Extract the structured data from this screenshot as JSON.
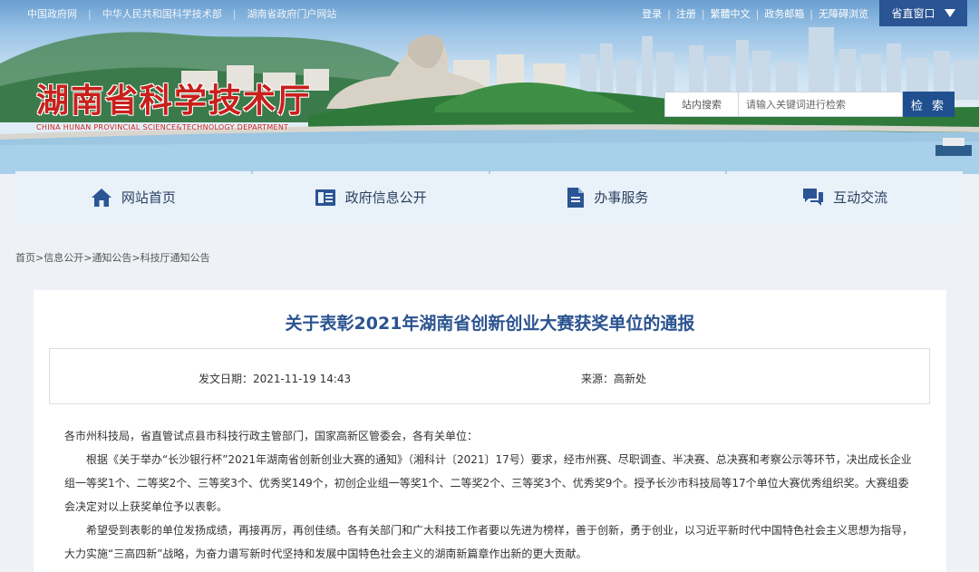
{
  "topbar": {
    "left_links": [
      "中国政府网",
      "中华人民共和国科学技术部",
      "湖南省政府门户网站"
    ],
    "right_links": [
      "登录",
      "注册",
      "繁體中文",
      "政务邮箱",
      "无障碍浏览"
    ],
    "region_button": "省直窗口"
  },
  "banner": {
    "site_title": "湖南省科学技术厅",
    "site_subtitle": "CHINA HUNAN PROVINCIAL SCIENCE&TECHNOLOGY DEPARTMENT"
  },
  "search": {
    "scope": "站内搜索",
    "placeholder": "请输入关键词进行检索",
    "button": "检 索"
  },
  "nav": {
    "items": [
      {
        "label": "网站首页",
        "icon": "home-icon"
      },
      {
        "label": "政府信息公开",
        "icon": "info-book-icon"
      },
      {
        "label": "办事服务",
        "icon": "document-icon"
      },
      {
        "label": "互动交流",
        "icon": "chat-icon"
      }
    ]
  },
  "breadcrumb": [
    "首页",
    "信息公开",
    "通知公告",
    "科技厅通知公告"
  ],
  "article": {
    "title": "关于表彰2021年湖南省创新创业大赛获奖单位的通报",
    "date_label": "发文日期：",
    "date": "2021-11-19 14:43",
    "source_label": "来源：",
    "source": "高新处",
    "paragraphs": [
      "各市州科技局，省直管试点县市科技行政主管部门，国家高新区管委会，各有关单位：",
      "根据《关于举办“长沙银行杯”2021年湖南省创新创业大赛的通知》（湘科计〔2021〕17号）要求，经市州赛、尽职调查、半决赛、总决赛和考察公示等环节，决出成长企业组一等奖1个、二等奖2个、三等奖3个、优秀奖149个，初创企业组一等奖1个、二等奖2个、三等奖3个、优秀奖9个。授予长沙市科技局等17个单位大赛优秀组织奖。大赛组委会决定对以上获奖单位予以表彰。",
      "希望受到表彰的单位发扬成绩，再接再厉，再创佳绩。各有关部门和广大科技工作者要以先进为榜样，善于创新，勇于创业，以习近平新时代中国特色社会主义思想为指导，大力实施“三高四新”战略，为奋力谱写新时代坚持和发展中国特色社会主义的湖南新篇章作出新的更大贡献。"
    ]
  },
  "colors": {
    "title_red": "#c8201c",
    "accent_blue": "#1f4f8f",
    "article_title": "#2b5390",
    "nav_bg": "#e9f1f9"
  }
}
